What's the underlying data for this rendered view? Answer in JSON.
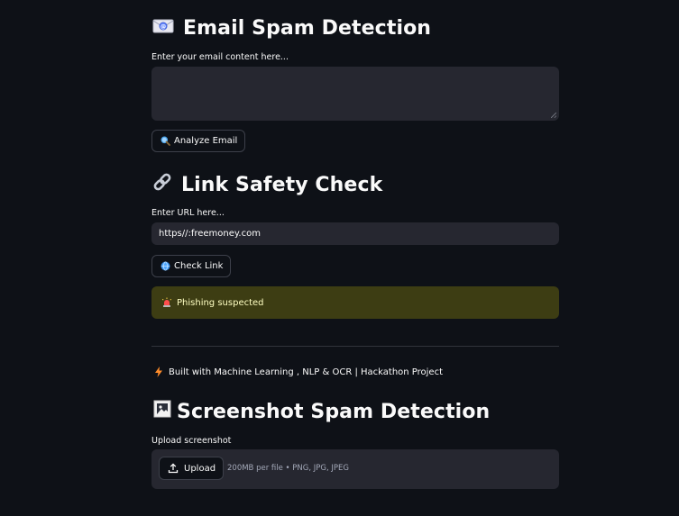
{
  "email_section": {
    "title": "Email Spam Detection",
    "icon": "email-envelope-icon",
    "label": "Enter your email content here...",
    "textarea_value": "",
    "button_label": "Analyze Email",
    "button_icon": "magnifier-icon"
  },
  "link_section": {
    "title": "Link Safety Check",
    "icon": "link-icon",
    "label": "Enter URL here...",
    "input_value": "https//:freemoney.com",
    "button_label": "Check Link",
    "button_icon": "globe-icon"
  },
  "alert": {
    "text": "Phishing suspected",
    "icon": "siren-icon",
    "background": "#3d3d13",
    "text_color": "#ffffc2"
  },
  "footer": {
    "text": "Built with Machine Learning , NLP & OCR | Hackathon Project",
    "icon": "lightning-icon"
  },
  "screenshot_section": {
    "title": "Screenshot Spam Detection",
    "icon": "frame-picture-icon",
    "label": "Upload screenshot",
    "upload_button_label": "Upload",
    "upload_hint": "200MB per file • PNG, JPG, JPEG"
  },
  "colors": {
    "background": "#0e1117",
    "input_background": "#262730",
    "text": "#fafafa"
  }
}
